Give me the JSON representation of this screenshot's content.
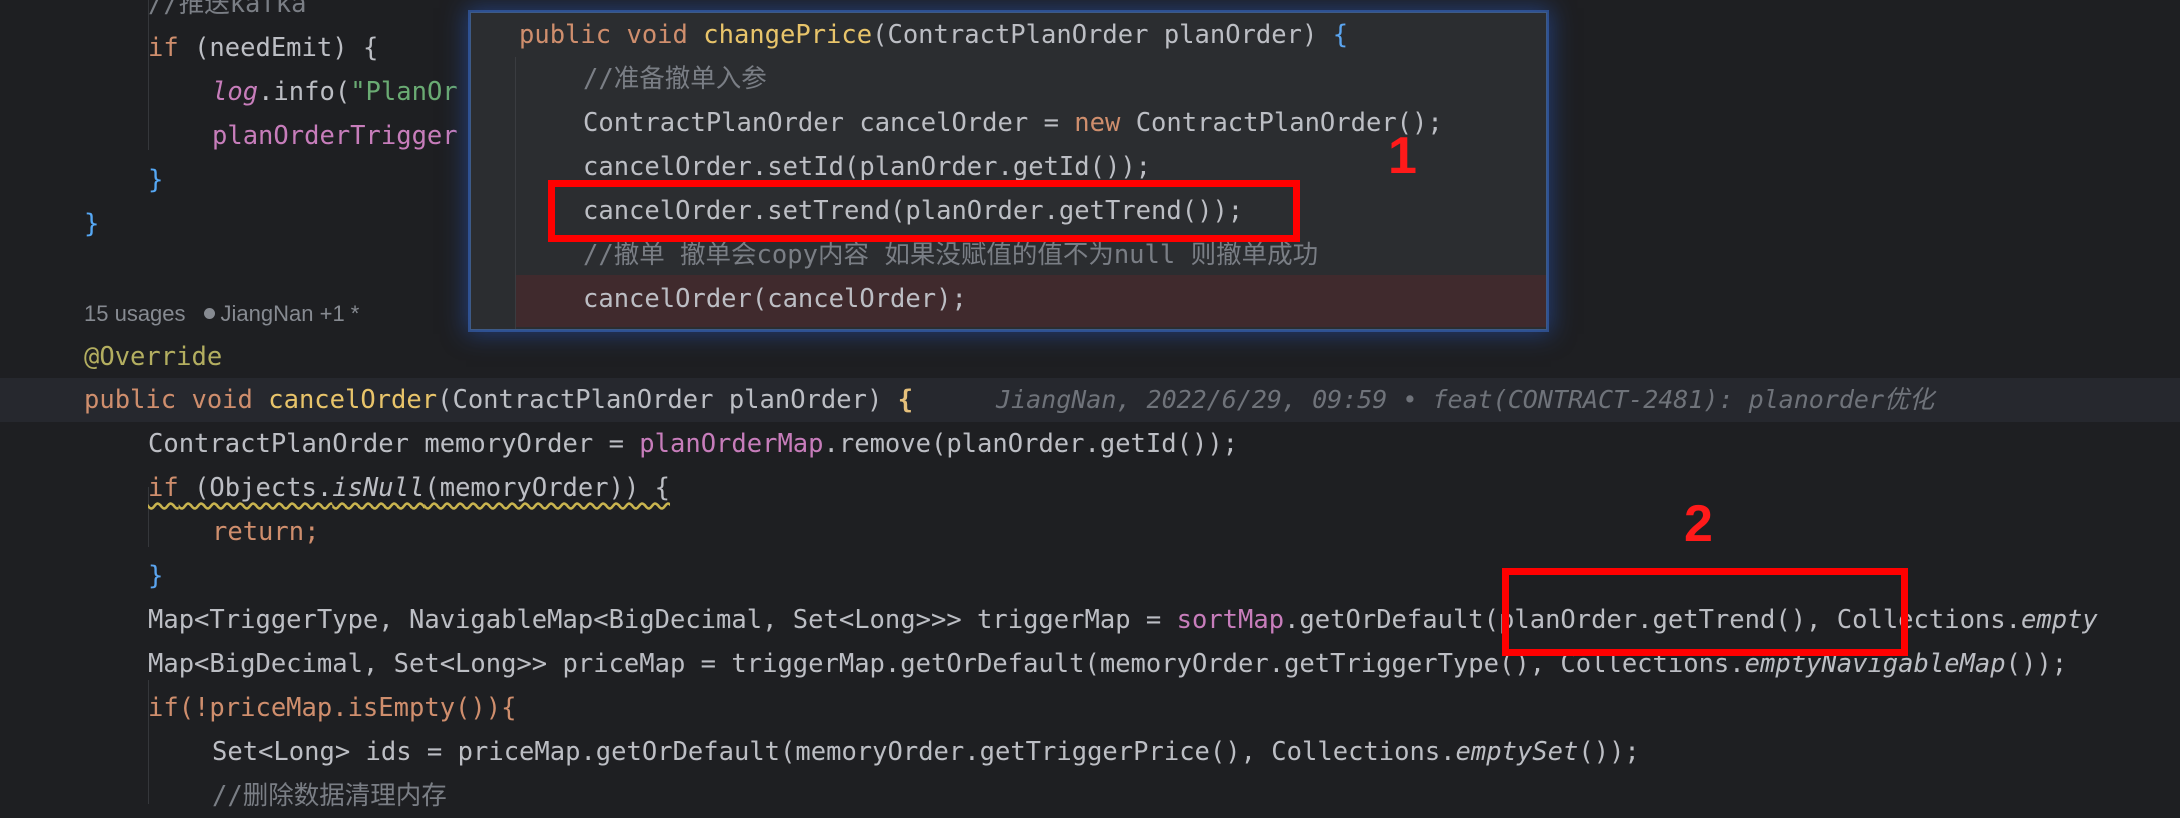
{
  "editor": {
    "l_kafka_comment": "//推送kafka",
    "l_if_kw": "if",
    "l_if_rest": " (needEmit) {",
    "l_log": "log",
    "l_log_info": ".info(",
    "l_log_str": "\"PlanOr",
    "l_trigger": "planOrderTrigger",
    "l_close1": "}",
    "l_close2": "}",
    "usages": "15 usages",
    "authors": "JiangNan +1 *",
    "override": "@Override",
    "sig_kw": "public void ",
    "sig_name": "cancelOrder",
    "sig_params": "(ContractPlanOrder planOrder) ",
    "sig_brace": "{",
    "blame": "JiangNan, 2022/6/29, 09:59 • feat(CONTRACT-2481): planorder优化",
    "l_memory_a": "ContractPlanOrder memoryOrder = ",
    "l_memory_b": "planOrderMap",
    "l_memory_c": ".remove(planOrder.getId());",
    "l_ifnull_kw": "if",
    "l_ifnull_a": " (Objects.",
    "l_ifnull_b": "isNull",
    "l_ifnull_c": "(memoryOrder)) {",
    "l_return": "return;",
    "l_close3": "}",
    "l_map_a": "Map<TriggerType, NavigableMap<BigDecimal, Set<Long>>> triggerMap = ",
    "l_map_b": "sortMap",
    "l_map_c": ".getOrDefault(planOrder.getTrend(), Collections.",
    "l_map_d": "empty",
    "l_price_a": "Map<BigDecimal, Set<Long>> priceMap = triggerMap.getOrDefault(memoryOrder.getTriggerType(), Collections.",
    "l_price_b": "emptyNavigableMap",
    "l_price_c": "());",
    "l_ifempty": "if(!priceMap.isEmpty()){",
    "l_ids_a": "Set<Long> ids = priceMap.getOrDefault(memoryOrder.getTriggerPrice(), Collections.",
    "l_ids_b": "emptySet",
    "l_ids_c": "());",
    "l_delete_comment": "//删除数据清理内存"
  },
  "popup": {
    "sig_kw": "public void ",
    "sig_name": "changePrice",
    "sig_params": "(ContractPlanOrder planOrder) ",
    "sig_brace": "{",
    "comment1": "//准备撤单入参",
    "new_a": "ContractPlanOrder cancelOrder = ",
    "new_kw": "new",
    "new_b": " ContractPlanOrder();",
    "setid": "cancelOrder.setId(planOrder.getId());",
    "settrend": "cancelOrder.setTrend(planOrder.getTrend());",
    "comment2": "//撤单 撤单会copy内容 如果没赋值的值不为null 则撤单成功",
    "cancel": "cancelOrder(cancelOrder);"
  },
  "annotations": {
    "label1": "1",
    "label2": "2",
    "color": "#ff0000"
  }
}
